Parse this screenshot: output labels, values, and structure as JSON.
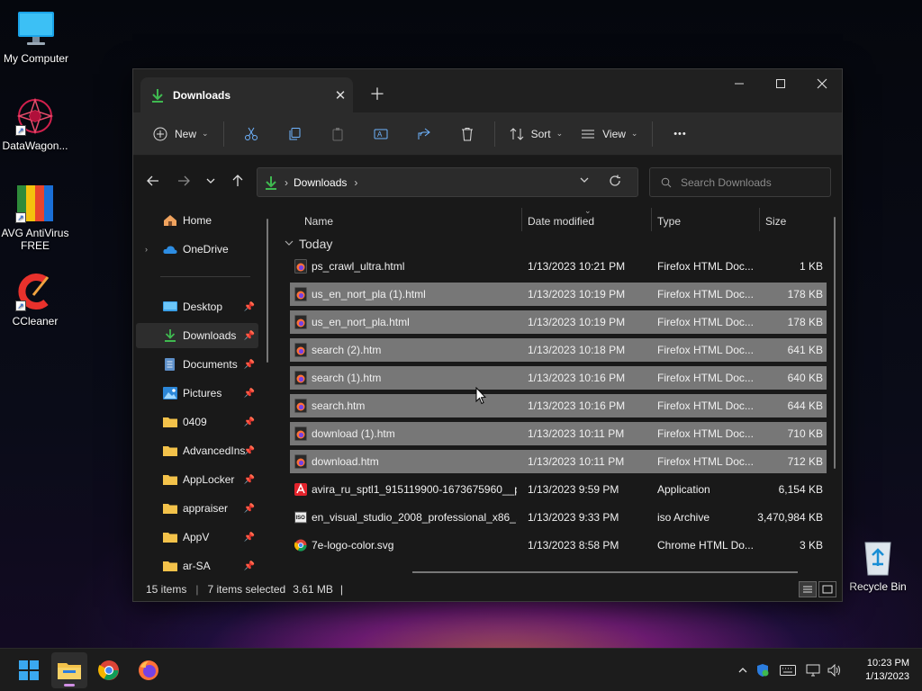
{
  "desktop": {
    "icons": [
      {
        "label": "My Computer"
      },
      {
        "label": "DataWagon..."
      },
      {
        "label": "AVG AntiVirus FREE"
      },
      {
        "label": "CCleaner"
      },
      {
        "label": "Recycle Bin"
      }
    ]
  },
  "window": {
    "tab_title": "Downloads",
    "toolbar": {
      "new_label": "New",
      "sort_label": "Sort",
      "view_label": "View",
      "more_label": "•••"
    },
    "address": {
      "crumb": "Downloads"
    },
    "search": {
      "placeholder": "Search Downloads"
    },
    "sidebar": {
      "items": [
        {
          "label": "Home"
        },
        {
          "label": "OneDrive"
        },
        {
          "label": "Desktop"
        },
        {
          "label": "Downloads"
        },
        {
          "label": "Documents"
        },
        {
          "label": "Pictures"
        },
        {
          "label": "0409"
        },
        {
          "label": "AdvancedIns"
        },
        {
          "label": "AppLocker"
        },
        {
          "label": "appraiser"
        },
        {
          "label": "AppV"
        },
        {
          "label": "ar-SA"
        }
      ]
    },
    "columns": {
      "name": "Name",
      "date": "Date modified",
      "type": "Type",
      "size": "Size"
    },
    "group_label": "Today",
    "files": [
      {
        "name": "ps_crawl_ultra.html",
        "date": "1/13/2023 10:21 PM",
        "type": "Firefox HTML Doc...",
        "size": "1 KB",
        "selected": false,
        "icon": "firefox"
      },
      {
        "name": "us_en_nort_pla (1).html",
        "date": "1/13/2023 10:19 PM",
        "type": "Firefox HTML Doc...",
        "size": "178 KB",
        "selected": true,
        "icon": "firefox"
      },
      {
        "name": "us_en_nort_pla.html",
        "date": "1/13/2023 10:19 PM",
        "type": "Firefox HTML Doc...",
        "size": "178 KB",
        "selected": true,
        "icon": "firefox"
      },
      {
        "name": "search (2).htm",
        "date": "1/13/2023 10:18 PM",
        "type": "Firefox HTML Doc...",
        "size": "641 KB",
        "selected": true,
        "icon": "firefox"
      },
      {
        "name": "search (1).htm",
        "date": "1/13/2023 10:16 PM",
        "type": "Firefox HTML Doc...",
        "size": "640 KB",
        "selected": true,
        "icon": "firefox"
      },
      {
        "name": "search.htm",
        "date": "1/13/2023 10:16 PM",
        "type": "Firefox HTML Doc...",
        "size": "644 KB",
        "selected": true,
        "icon": "firefox"
      },
      {
        "name": "download (1).htm",
        "date": "1/13/2023 10:11 PM",
        "type": "Firefox HTML Doc...",
        "size": "710 KB",
        "selected": true,
        "icon": "firefox"
      },
      {
        "name": "download.htm",
        "date": "1/13/2023 10:11 PM",
        "type": "Firefox HTML Doc...",
        "size": "712 KB",
        "selected": true,
        "icon": "firefox"
      },
      {
        "name": "avira_ru_sptl1_915119900-1673675960__p...",
        "date": "1/13/2023 9:59 PM",
        "type": "Application",
        "size": "6,154 KB",
        "selected": false,
        "icon": "avira"
      },
      {
        "name": "en_visual_studio_2008_professional_x86_...",
        "date": "1/13/2023 9:33 PM",
        "type": "iso Archive",
        "size": "3,470,984 KB",
        "selected": false,
        "icon": "iso"
      },
      {
        "name": "7e-logo-color.svg",
        "date": "1/13/2023 8:58 PM",
        "type": "Chrome HTML Do...",
        "size": "3 KB",
        "selected": false,
        "icon": "chrome"
      }
    ],
    "status": {
      "items_count": "15 items",
      "selected_count": "7 items selected",
      "selected_size": "3.61 MB",
      "trailing": "|"
    }
  },
  "taskbar": {
    "clock_time": "10:23 PM",
    "clock_date": "1/13/2023"
  },
  "colors": {
    "selection": "#777777",
    "accent_green": "#3fb950",
    "folder_yellow": "#f3c24a"
  }
}
